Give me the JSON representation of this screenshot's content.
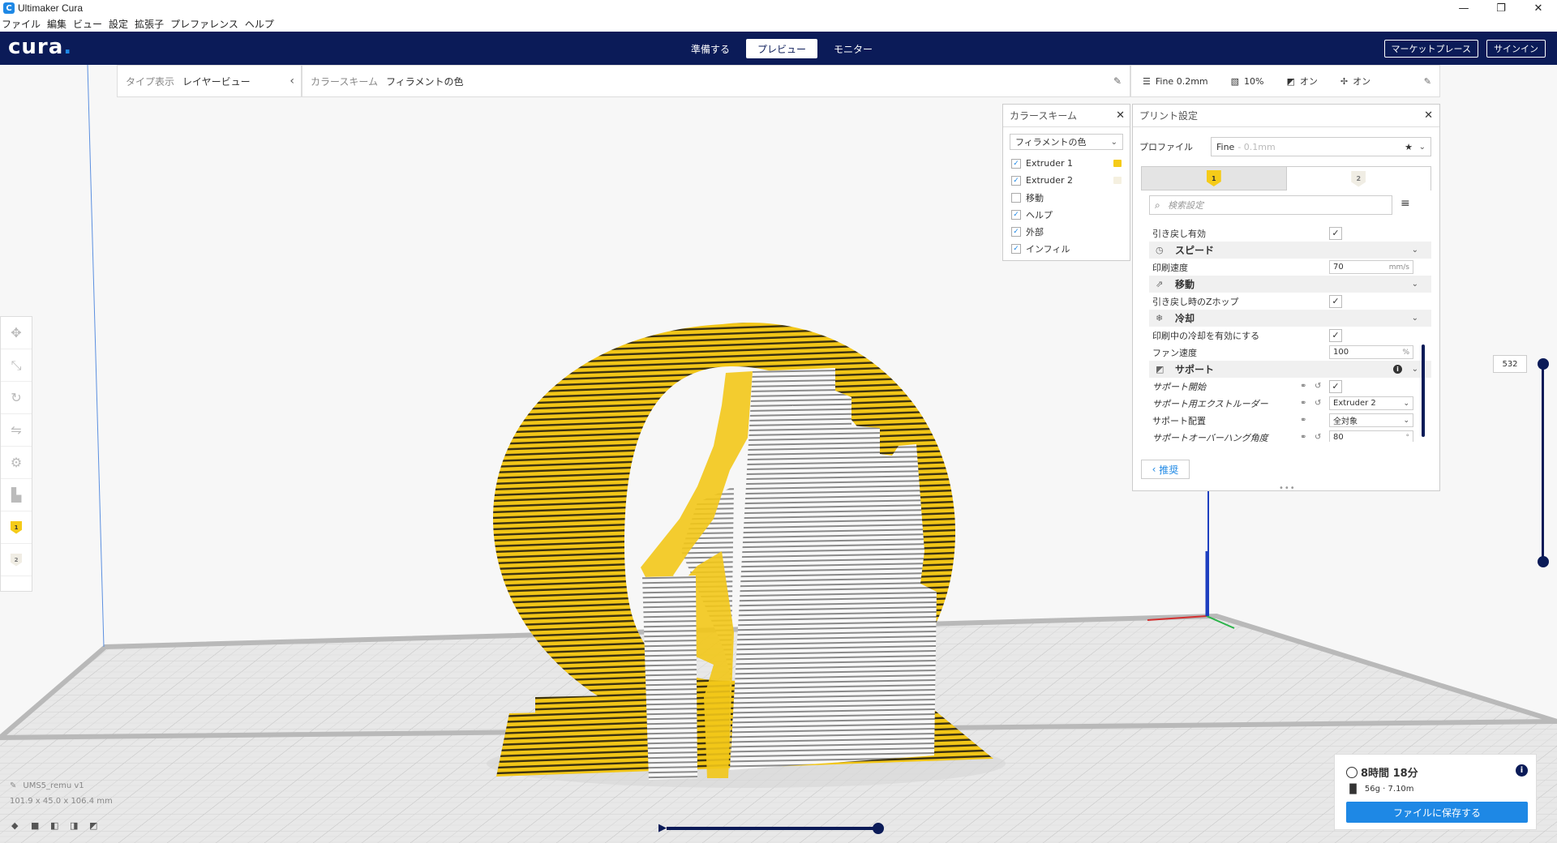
{
  "window": {
    "title": "Ultimaker Cura",
    "app_icon": "C",
    "controls": [
      "—",
      "❐",
      "✕"
    ]
  },
  "menu": [
    "ファイル",
    "編集",
    "ビュー",
    "設定",
    "拡張子",
    "プレファレンス",
    "ヘルプ"
  ],
  "header": {
    "logo": "cura",
    "stages": [
      "準備する",
      "プレビュー",
      "モニター"
    ],
    "active_stage": 1,
    "marketplace": "マーケットプレース",
    "signin": "サインイン"
  },
  "viewbar": {
    "label": "タイプ表示",
    "value": "レイヤービュー",
    "chevron": "‹"
  },
  "schemebar": {
    "label": "カラースキーム",
    "value": "フィラメントの色"
  },
  "printbar": {
    "profile": "Fine 0.2mm",
    "infill": "10%",
    "support": "オン",
    "adhesion": "オン"
  },
  "colorscheme_panel": {
    "title": "カラースキーム",
    "selected": "フィラメントの色",
    "items": [
      {
        "label": "Extruder 1",
        "checked": true,
        "swatch": "#f5cb19"
      },
      {
        "label": "Extruder 2",
        "checked": true,
        "swatch": "#f5f0e0"
      },
      {
        "label": "移動",
        "checked": false
      },
      {
        "label": "ヘルプ",
        "checked": true
      },
      {
        "label": "外部",
        "checked": true
      },
      {
        "label": "インフィル",
        "checked": true
      }
    ]
  },
  "print_settings": {
    "title": "プリント設定",
    "profile_label": "プロファイル",
    "profile_value": "Fine",
    "profile_dim": "- 0.1mm",
    "extruder_tabs": [
      "1",
      "2"
    ],
    "search_placeholder": "検索設定",
    "rows": [
      {
        "type": "setting",
        "name": "引き戻し有効",
        "control": "check",
        "checked": true
      },
      {
        "type": "category",
        "name": "スピード",
        "icon": "speed-icon"
      },
      {
        "type": "setting",
        "name": "印刷速度",
        "control": "field",
        "value": "70",
        "unit": "mm/s"
      },
      {
        "type": "category",
        "name": "移動",
        "icon": "travel-icon"
      },
      {
        "type": "setting",
        "name": "引き戻し時のZホップ",
        "control": "check",
        "checked": true
      },
      {
        "type": "category",
        "name": "冷却",
        "icon": "cooling-icon"
      },
      {
        "type": "setting",
        "name": "印刷中の冷却を有効にする",
        "control": "check",
        "checked": true
      },
      {
        "type": "setting",
        "name": "ファン速度",
        "control": "field",
        "value": "100",
        "unit": "%"
      },
      {
        "type": "category",
        "name": "サポート",
        "icon": "support-icon",
        "info": true
      },
      {
        "type": "setting",
        "name": "サポート開始",
        "control": "check",
        "checked": true,
        "italic": true,
        "link": true,
        "reset": true
      },
      {
        "type": "setting",
        "name": "サポート用エクストルーダー",
        "control": "select",
        "value": "Extruder 2",
        "italic": true,
        "link": true,
        "reset": true
      },
      {
        "type": "setting",
        "name": "サポート配置",
        "control": "select",
        "value": "全対象",
        "link": true
      },
      {
        "type": "setting",
        "name": "サポートオーバーハング角度",
        "control": "field",
        "value": "80",
        "unit": "°",
        "italic": true,
        "link": true,
        "reset": true
      }
    ],
    "recommended": "推奨"
  },
  "layer_slider": {
    "current_layer": "532"
  },
  "object": {
    "name": "UMS5_remu v1",
    "dimensions": "101.9 x 45.0 x 106.4 mm"
  },
  "print_summary": {
    "time": "8時間 18分",
    "material": "56g · 7.10m",
    "save_button": "ファイルに保存する"
  },
  "colors": {
    "header": "#0b1b58",
    "accent": "#1e88e5",
    "extruder1": "#f5cb19",
    "extruder2": "#f5f0e0"
  }
}
